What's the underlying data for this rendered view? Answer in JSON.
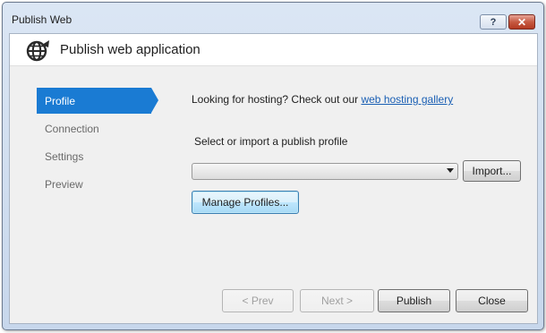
{
  "window": {
    "title": "Publish Web",
    "help_label": "?",
    "close_label": "✕"
  },
  "header": {
    "icon": "globe-publish-icon",
    "title": "Publish web application"
  },
  "nav": {
    "items": [
      {
        "label": "Profile",
        "selected": true
      },
      {
        "label": "Connection",
        "selected": false
      },
      {
        "label": "Settings",
        "selected": false
      },
      {
        "label": "Preview",
        "selected": false
      }
    ]
  },
  "profile_page": {
    "hosting_text": "Looking for hosting? Check out our",
    "hosting_link": "web hosting gallery",
    "select_label": "Select or import a publish profile",
    "profile_value": "",
    "import_label": "Import...",
    "manage_label": "Manage Profiles..."
  },
  "footer": {
    "prev_label": "< Prev",
    "next_label": "Next >",
    "publish_label": "Publish",
    "close_label": "Close"
  },
  "colors": {
    "nav_selected": "#1a7bd3",
    "link": "#1a5fb4"
  }
}
